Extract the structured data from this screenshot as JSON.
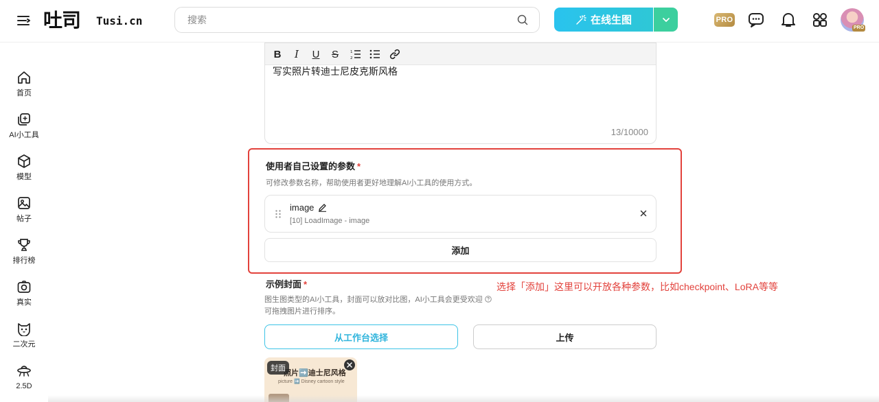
{
  "header": {
    "logo_main": "吐司",
    "logo_sub": "Tusi.cn",
    "search_placeholder": "搜索",
    "generate_label": "在线生图",
    "pro_badge": "PRO",
    "avatar_badge": "PRO"
  },
  "sidebar": {
    "items": [
      {
        "label": "首页",
        "icon": "home-icon"
      },
      {
        "label": "AI小工具",
        "icon": "ai-tools-icon"
      },
      {
        "label": "模型",
        "icon": "model-cube-icon"
      },
      {
        "label": "帖子",
        "icon": "image-post-icon"
      },
      {
        "label": "排行榜",
        "icon": "trophy-icon"
      },
      {
        "label": "真实",
        "icon": "camera-icon"
      },
      {
        "label": "二次元",
        "icon": "cat-face-icon"
      },
      {
        "label": "2.5D",
        "icon": "ufo-icon"
      }
    ]
  },
  "editor": {
    "toolbar": [
      "B",
      "I",
      "U",
      "S",
      "ordered-list",
      "bullet-list",
      "link"
    ],
    "content": "写实照片转迪士尼皮克斯风格",
    "char_count": "13/10000"
  },
  "params": {
    "title": "使用者自己设置的参数",
    "required_mark": "*",
    "description": "可修改参数名称，帮助使用者更好地理解AI小工具的使用方式。",
    "items": [
      {
        "name": "image",
        "source": "[10] LoadImage - image"
      }
    ],
    "add_label": "添加"
  },
  "annotation": "选择「添加」这里可以开放各种参数，比如checkpoint、LoRA等等",
  "cover": {
    "title": "示例封面",
    "required_mark": "*",
    "desc_line1": "图生图类型的AI小工具，封面可以放对比图，AI小工具会更受欢迎",
    "desc_line2": "可拖拽图片进行排序。",
    "workspace_label": "从工作台选择",
    "upload_label": "上传",
    "thumb_badge": "封面",
    "thumb_title": "照片➡️迪士尼风格",
    "thumb_sub": "picture ➡️ Disney cartoon style"
  },
  "colors": {
    "accent": "#2fb4dc",
    "generate_gradient_start": "#2ac3ee",
    "dropdown": "#3ccf9e",
    "annotation_red": "#e2413b"
  }
}
